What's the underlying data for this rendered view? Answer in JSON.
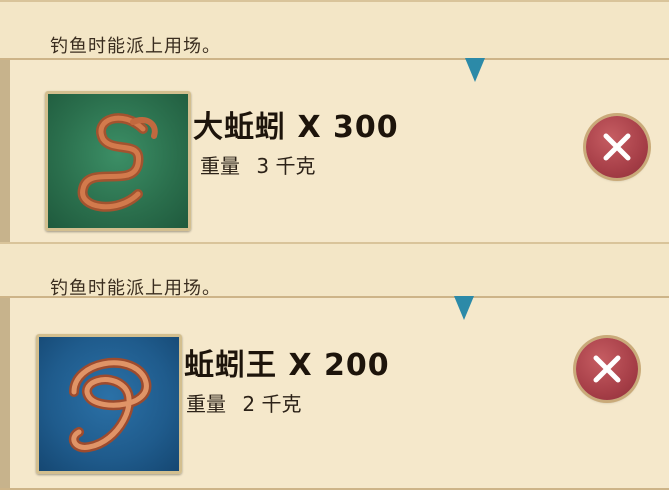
{
  "items": [
    {
      "description": "钓鱼时能派上用场。",
      "title": "大蚯蚓 X 300",
      "weight_label": "重量",
      "weight_value": "3 千克",
      "icon": "earthworm-icon",
      "color": "#2a6e4c"
    },
    {
      "description": "钓鱼时能派上用场。",
      "title": "蚯蚓王 X 200",
      "weight_label": "重量",
      "weight_value": "2 千克",
      "icon": "earthworm-king-icon",
      "color": "#1f5b8c"
    }
  ],
  "close_icon": "close-icon",
  "accent": "#a73f48"
}
